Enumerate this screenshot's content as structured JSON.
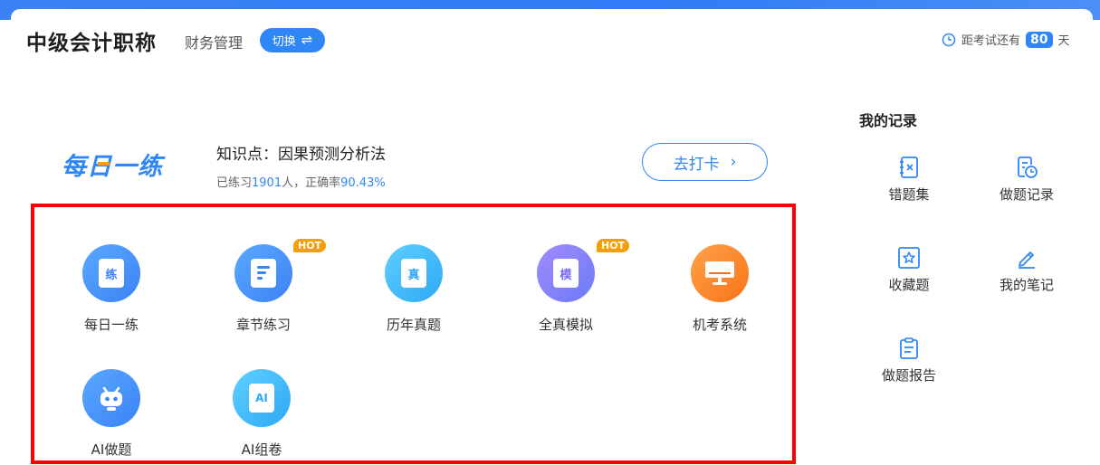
{
  "header": {
    "title": "中级会计职称",
    "subject": "财务管理",
    "switch_label": "切换",
    "countdown_prefix": "距考试还有",
    "countdown_days": "80",
    "countdown_suffix": "天"
  },
  "daily": {
    "logo": "每日一练",
    "knowledge_point": "知识点：因果预测分析法",
    "stats_prefix": "已练习",
    "practiced_count": "1901",
    "stats_middle": "人，正确率",
    "accuracy": "90.43%",
    "checkin_label": "去打卡"
  },
  "features": [
    {
      "label": "每日一练",
      "icon_text": "练",
      "icon": "practice-icon",
      "color_from": "#5aa8ff",
      "color_to": "#3b82f6"
    },
    {
      "label": "章节练习",
      "icon_text": "",
      "icon": "document-icon",
      "color_from": "#5aa8ff",
      "color_to": "#3b82f6",
      "badge": "HOT"
    },
    {
      "label": "历年真题",
      "icon_text": "真",
      "icon": "past-exam-icon",
      "color_from": "#5ed0ff",
      "color_to": "#2fa8f5"
    },
    {
      "label": "全真模拟",
      "icon_text": "模",
      "icon": "mock-exam-icon",
      "color_from": "#a18bff",
      "color_to": "#6b7bf5",
      "badge": "HOT"
    },
    {
      "label": "机考系统",
      "icon_text": "",
      "icon": "computer-icon",
      "color_from": "#ffa24a",
      "color_to": "#f97316"
    },
    {
      "label": "AI做题",
      "icon_text": "",
      "icon": "robot-icon",
      "color_from": "#5aa8ff",
      "color_to": "#3b82f6"
    },
    {
      "label": "AI组卷",
      "icon_text": "AI",
      "icon": "ai-paper-icon",
      "color_from": "#5ed0ff",
      "color_to": "#2fa8f5"
    }
  ],
  "records": {
    "title": "我的记录",
    "items": [
      {
        "label": "错题集",
        "icon": "wrong-book-icon"
      },
      {
        "label": "做题记录",
        "icon": "history-icon"
      },
      {
        "label": "收藏题",
        "icon": "star-icon"
      },
      {
        "label": "我的笔记",
        "icon": "pen-icon"
      },
      {
        "label": "做题报告",
        "icon": "report-icon"
      }
    ]
  },
  "colors": {
    "accent": "#2f86f6",
    "hot": "#f59e0b",
    "highlight_box": "#ff0000"
  }
}
